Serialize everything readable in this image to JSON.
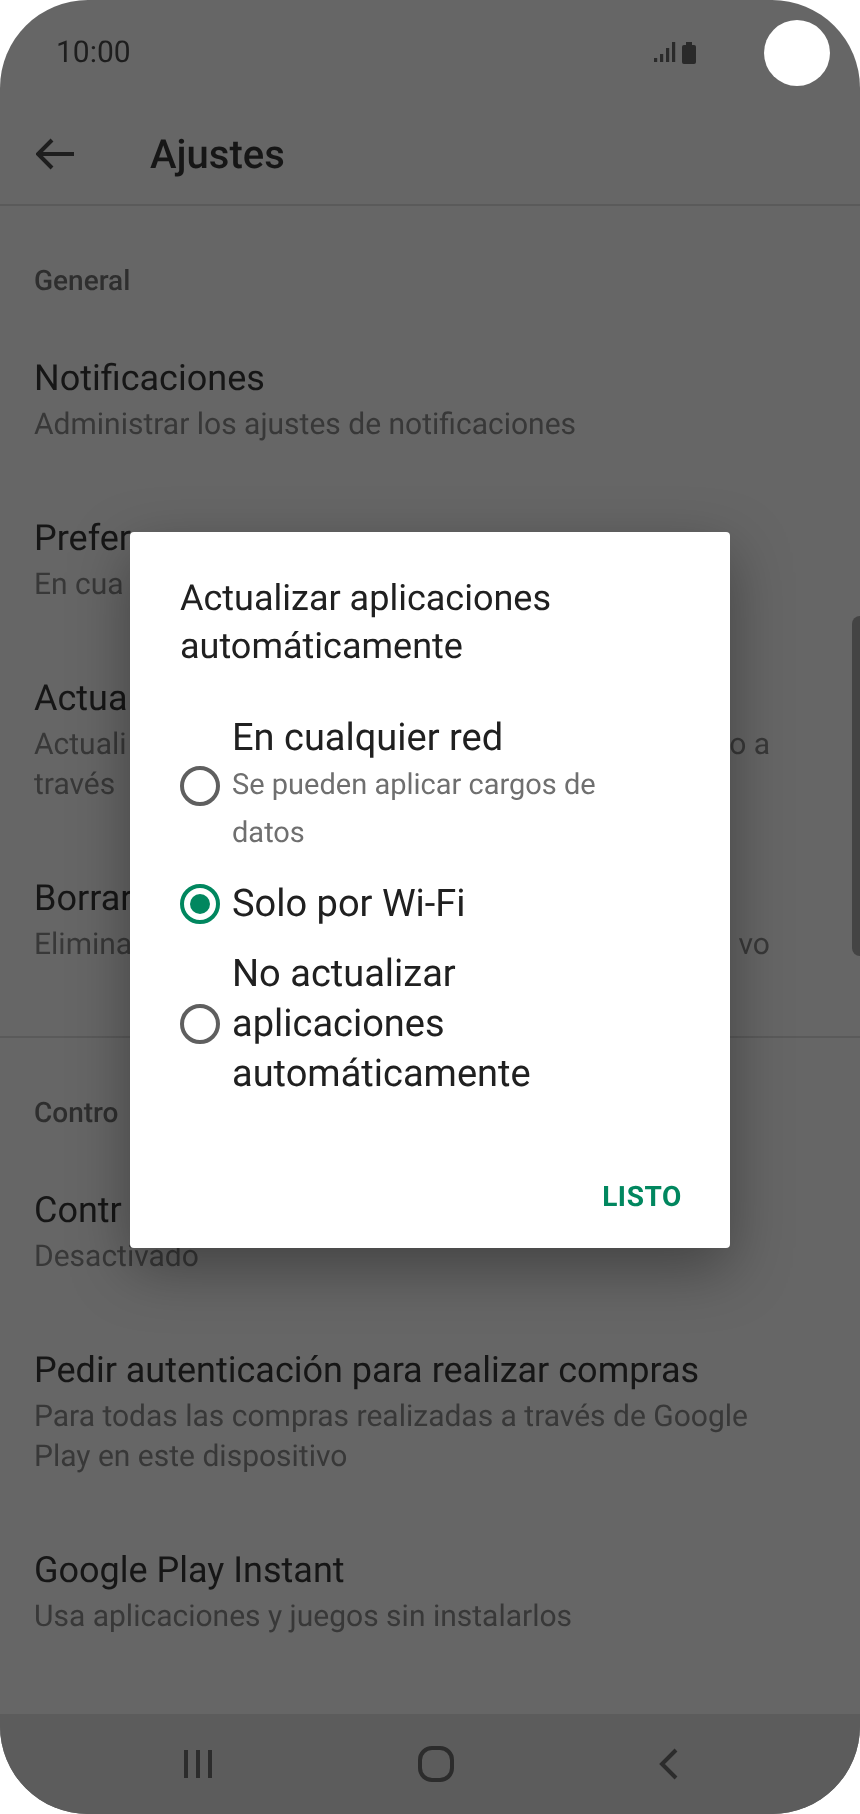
{
  "status_bar": {
    "time": "10:00"
  },
  "app_bar": {
    "title": "Ajustes"
  },
  "sections": [
    {
      "header": "General",
      "items": [
        {
          "title": "Notificaciones",
          "subtitle": [
            "Administrar los ajustes de notificaciones"
          ]
        },
        {
          "title": "Prefer",
          "subtitle": [
            "En cua"
          ]
        },
        {
          "title": "Actua",
          "subtitle": [
            "Actuali",
            "través"
          ],
          "subtitle_end": "o a"
        },
        {
          "title": "Borrar",
          "subtitle": [
            "Elimina"
          ],
          "subtitle_end": "vo"
        }
      ]
    },
    {
      "header": "Contro",
      "items": [
        {
          "title": "Contr",
          "subtitle": [
            "Desactivado"
          ]
        },
        {
          "title": "Pedir autenticación para realizar compras",
          "subtitle": [
            "Para todas las compras realizadas a través de Google Play en este dispositivo"
          ]
        },
        {
          "title": "Google Play Instant",
          "subtitle": [
            "Usa aplicaciones y juegos sin instalarlos"
          ]
        }
      ]
    }
  ],
  "dialog": {
    "title": "Actualizar aplicaciones automáticamente",
    "options": [
      {
        "label": "En cualquier red",
        "description": "Se pueden aplicar cargos de datos",
        "selected": false
      },
      {
        "label": "Solo por Wi-Fi",
        "selected": true
      },
      {
        "label": "No actualizar aplicaciones automáticamente",
        "selected": false
      }
    ],
    "button": "LISTO"
  }
}
